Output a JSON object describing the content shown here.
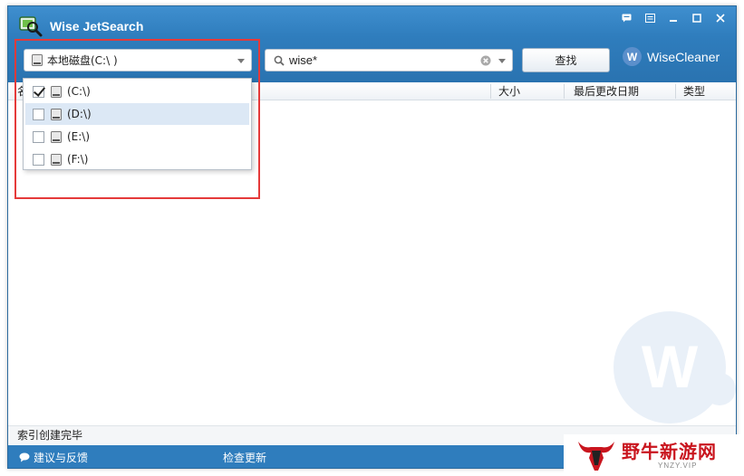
{
  "app": {
    "title": "Wise JetSearch",
    "brand": "WiseCleaner",
    "brand_badge": "W"
  },
  "toolbar": {
    "drive_selected": "本地磁盘(C:\\ )",
    "search_value": "wise*",
    "find_label": "查找"
  },
  "columns": {
    "name": "名",
    "size": "大小",
    "modified": "最后更改日期",
    "type": "类型"
  },
  "drive_options": [
    {
      "label": "(C:\\)",
      "checked": true
    },
    {
      "label": "(D:\\)",
      "checked": false
    },
    {
      "label": "(E:\\)",
      "checked": false
    },
    {
      "label": "(F:\\)",
      "checked": false
    }
  ],
  "status": {
    "text": "索引创建完毕"
  },
  "footer": {
    "feedback": "建议与反馈",
    "update": "检查更新"
  },
  "watermark": {
    "letter": "W",
    "site_name": "野牛新游网",
    "site_url": "YNZY.VIP"
  },
  "colors": {
    "titlebar": "#2f7dbd",
    "highlight": "#e53a3a",
    "hover": "#dce8f5"
  }
}
